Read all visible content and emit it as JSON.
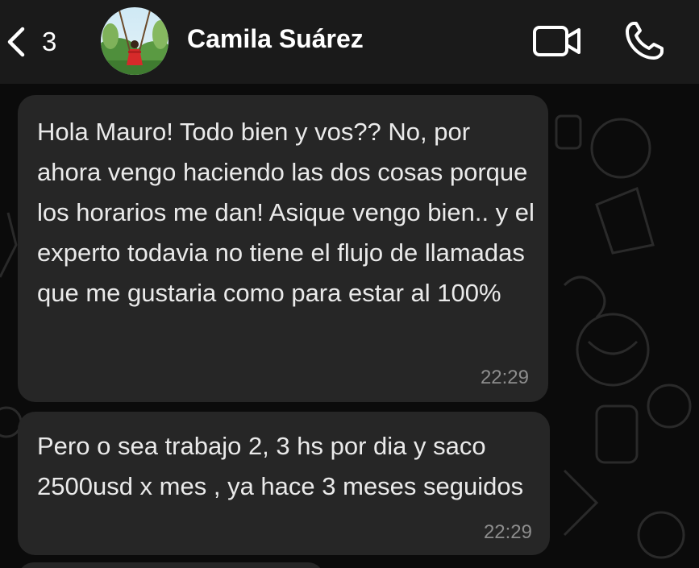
{
  "header": {
    "back_count": "3",
    "contact_name": "Camila Suárez",
    "avatar_icon": "profile-photo",
    "video_icon": "video-camera-icon",
    "call_icon": "phone-icon"
  },
  "messages": [
    {
      "text": "Hola Mauro! Todo bien y vos?? No, por ahora vengo haciendo las dos cosas porque los horarios me dan! Asique vengo bien.. y el experto todavia no tiene el flujo de llamadas que me gustaria como para estar al 100%",
      "time": "22:29"
    },
    {
      "text": "Pero o sea trabajo 2, 3 hs por dia y saco 2500usd x mes , ya hace 3 meses seguidos",
      "time": "22:29"
    }
  ],
  "colors": {
    "header_bg": "#1a1a1a",
    "chat_bg": "#0b0b0b",
    "bubble_bg": "#262626",
    "time_color": "#8d8d8d"
  }
}
